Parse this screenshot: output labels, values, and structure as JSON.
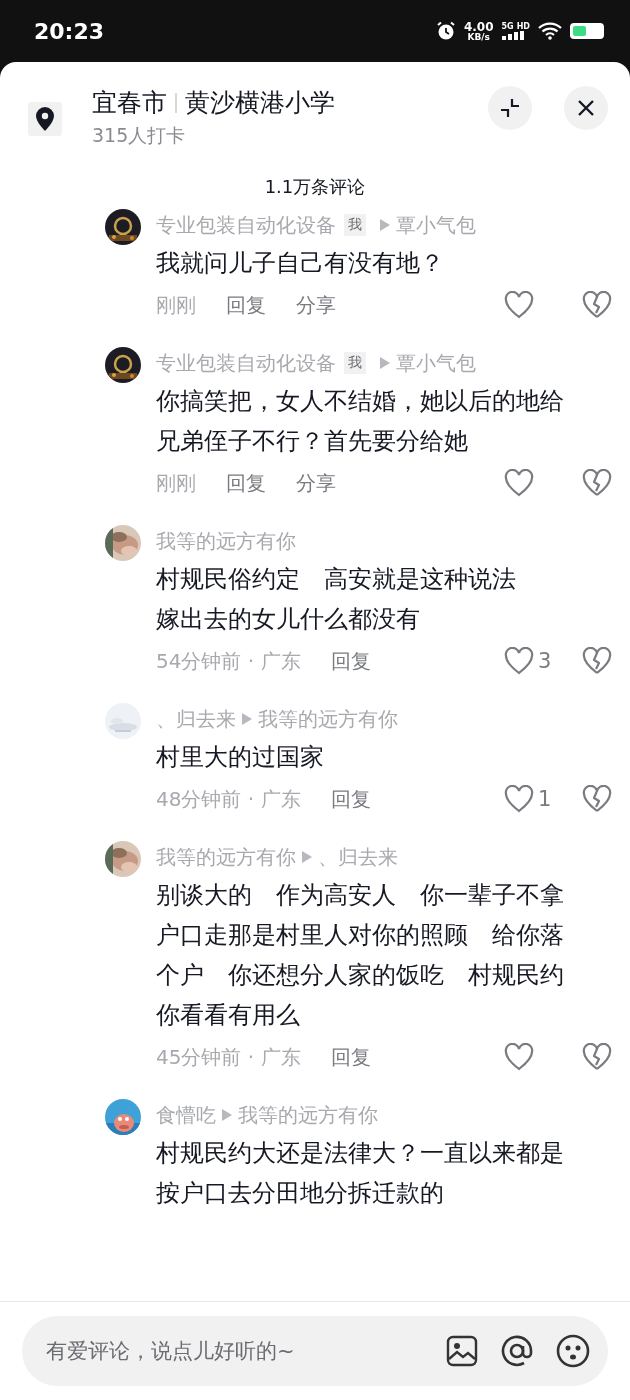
{
  "status_bar": {
    "time": "20:23",
    "net_speed": "4.00",
    "net_unit": "KB/s",
    "network": "5G",
    "network_badge": "HD"
  },
  "header": {
    "city": "宜春市",
    "place": "黄沙横港小学",
    "checkins": "315人打卡"
  },
  "comment_count": "1.1万条评论",
  "comments": [
    {
      "author": "专业包装自动化设备",
      "tag": "我",
      "reply_to": "覃小气包",
      "lines": [
        "我就问儿子自己有没有地？"
      ],
      "time": "刚刚",
      "actions": [
        "回复",
        "分享"
      ]
    },
    {
      "author": "专业包装自动化设备",
      "tag": "我",
      "reply_to": "覃小气包",
      "lines": [
        "你搞笑把，女人不结婚，她以后的地给兄弟侄子不行？首先要分给她"
      ],
      "time": "刚刚",
      "actions": [
        "回复",
        "分享"
      ]
    },
    {
      "author": "我等的远方有你",
      "lines": [
        "村规民俗约定　高安就是这种说法",
        "嫁出去的女儿什么都没有"
      ],
      "time": "54分钟前 · 广东",
      "actions": [
        "回复"
      ],
      "likes": "3"
    },
    {
      "author": "、归去来",
      "reply_to": "我等的远方有你",
      "lines": [
        "村里大的过国家"
      ],
      "time": "48分钟前 · 广东",
      "actions": [
        "回复"
      ],
      "likes": "1"
    },
    {
      "author": "我等的远方有你",
      "reply_to": "、归去来",
      "lines": [
        "别谈大的　作为高安人　你一辈子不拿户口走那是村里人对你的照顾　给你落个户　你还想分人家的饭吃　村规民约你看看有用么"
      ],
      "time": "45分钟前 · 广东",
      "actions": [
        "回复"
      ]
    },
    {
      "author": "食懵吃",
      "reply_to": "我等的远方有你",
      "lines": [
        "村规民约大还是法律大？一直以来都是按户口去分田地分拆迁款的"
      ]
    }
  ],
  "input": {
    "placeholder": "有爱评论，说点儿好听的~"
  }
}
